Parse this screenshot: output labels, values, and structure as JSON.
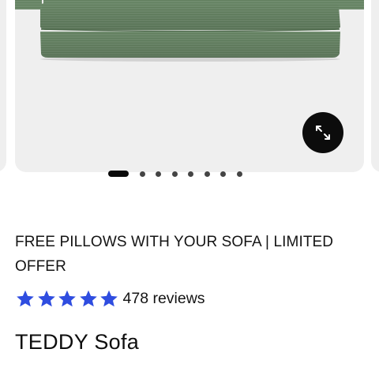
{
  "gallery": {
    "image_name": "sofa-image",
    "expand_icon": "expand-arrows-icon",
    "dots": {
      "total": 8,
      "active": 0
    }
  },
  "product": {
    "promo": "FREE PILLOWS WITH YOUR SOFA | LIMITED OFFER",
    "rating": {
      "stars": 5,
      "icon": "star-icon",
      "color": "#2f4de0"
    },
    "reviews": "478 reviews",
    "title": "TEDDY Sofa"
  },
  "colors": {
    "gallery_bg": "#efefef",
    "sofa": "#6f8b6d",
    "button": "#0c0c0c"
  }
}
